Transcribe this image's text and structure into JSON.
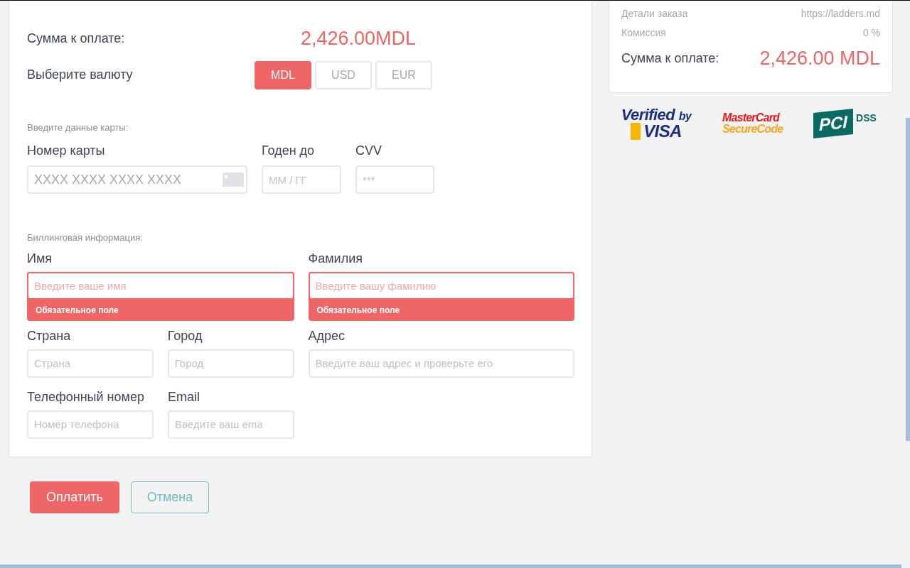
{
  "payment": {
    "amount_label": "Сумма к оплате:",
    "amount": "2,426.00MDL",
    "currency_label": "Выберите валюту",
    "currencies": [
      {
        "label": "MDL",
        "selected": true
      },
      {
        "label": "USD",
        "selected": false
      },
      {
        "label": "EUR",
        "selected": false
      }
    ]
  },
  "card_section": {
    "heading": "Введите данные карты:",
    "fields": [
      {
        "label": "Номер карты",
        "placeholder": "XXXX XXXX XXXX XXXX",
        "kind": "card"
      },
      {
        "label": "Годен до",
        "placeholder": "ММ / ГГ",
        "kind": "text"
      },
      {
        "label": "CVV",
        "placeholder": "***",
        "kind": "text"
      }
    ]
  },
  "billing": {
    "heading": "Биллинговая информация:",
    "fields": [
      {
        "label": "Имя",
        "placeholder": "Введите ваше имя",
        "error": "Обязательное поле"
      },
      {
        "label": "Фамилия",
        "placeholder": "Введите вашу фамилию",
        "error": "Обязательное поле"
      },
      {
        "label": "Страна",
        "placeholder": "Страна"
      },
      {
        "label": "Город",
        "placeholder": "Город"
      },
      {
        "label": "Адрес",
        "placeholder": "Введите ваш адрес и проверьте его"
      },
      {
        "label": "Телефонный номер",
        "placeholder": "Номер телефона"
      },
      {
        "label": "Email",
        "placeholder": "Введите ваш ema"
      }
    ]
  },
  "buttons": {
    "pay": "Оплатить",
    "cancel": "Отмена"
  },
  "summary": {
    "rows": [
      {
        "label": "Детали заказа",
        "value": "https://ladders.md"
      },
      {
        "label": "Комиссия",
        "value": "0 %"
      }
    ],
    "total_label": "Сумма к оплате:",
    "total": "2,426.00 MDL"
  },
  "badges": [
    {
      "kind": "visa",
      "line_1": "Verified",
      "line_2": "by",
      "line_3": "VISA"
    },
    {
      "kind": "mastercard",
      "line_1": "MasterCard",
      "line_2": "SecureCode"
    },
    {
      "kind": "pci",
      "line_1": "PCI",
      "line_2": "DSS"
    }
  ]
}
